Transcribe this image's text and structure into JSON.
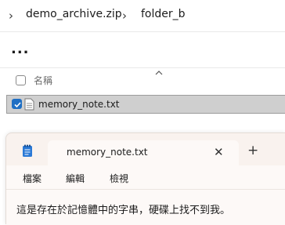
{
  "breadcrumb": {
    "items": [
      "demo_archive.zip",
      "folder_b"
    ]
  },
  "toolbar": {
    "more_label": "..."
  },
  "file_list": {
    "header": {
      "name_label": "名稱"
    },
    "rows": [
      {
        "name": "memory_note.txt",
        "selected": true
      }
    ]
  },
  "notepad": {
    "tab_title": "memory_note.txt",
    "close_glyph": "✕",
    "new_tab_glyph": "+",
    "menu": [
      "檔案",
      "編輯",
      "檢視"
    ],
    "content": "這是存在於記憶體中的字串，硬碟上找不到我。"
  },
  "colors": {
    "selection_bg": "#cfcfcf",
    "checkbox_accent": "#1f6fc4",
    "notepad_bg": "#fdf9f7"
  }
}
